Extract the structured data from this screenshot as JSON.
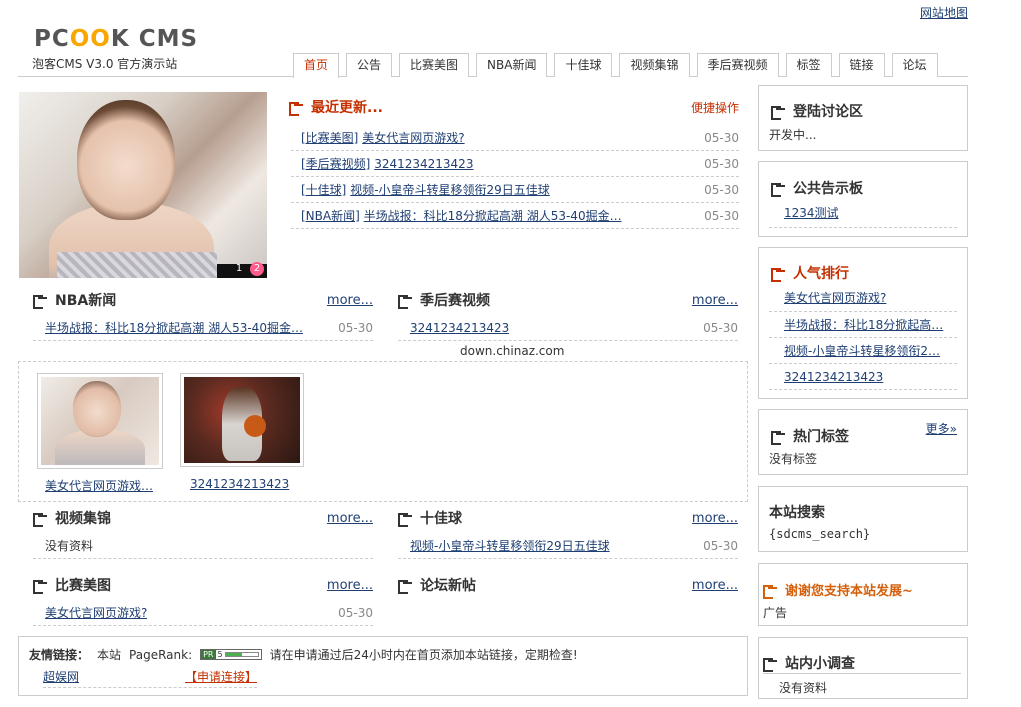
{
  "header": {
    "sitemap": "网站地图",
    "logo_prefix": "PC",
    "logo_oo": "OO",
    "logo_suffix": "K CMS",
    "subtitle": "泡客CMS V3.0 官方演示站",
    "nav": [
      "首页",
      "公告",
      "比赛美图",
      "NBA新闻",
      "十佳球",
      "视频集锦",
      "季后赛视频",
      "标签",
      "链接",
      "论坛"
    ],
    "active_tab": "首页"
  },
  "slider": {
    "pages": [
      "1",
      "2"
    ],
    "current": "2"
  },
  "recent": {
    "title": "最近更新...",
    "quick": "便捷操作",
    "items": [
      {
        "cat": "[比赛美图]",
        "title": "美女代言网页游戏?",
        "date": "05-30"
      },
      {
        "cat": "[季后赛视频]",
        "title": "3241234213423",
        "date": "05-30"
      },
      {
        "cat": "[十佳球]",
        "title": "视频-小皇帝斗转星移领衔29日五佳球",
        "date": "05-30"
      },
      {
        "cat": "[NBA新闻]",
        "title": "半场战报：科比18分掀起高潮 湖人53-40掘金…",
        "date": "05-30"
      }
    ]
  },
  "sections": {
    "nba": {
      "title": "NBA新闻",
      "more": "more...",
      "items": [
        {
          "title": "半场战报：科比18分掀起高潮 湖人53-40掘金…",
          "date": "05-30"
        }
      ]
    },
    "playoff": {
      "title": "季后赛视频",
      "more": "more...",
      "items": [
        {
          "title": "3241234213423",
          "date": "05-30"
        }
      ]
    },
    "video": {
      "title": "视频集锦",
      "more": "more...",
      "empty": "没有资料"
    },
    "top10": {
      "title": "十佳球",
      "more": "more...",
      "items": [
        {
          "title": "视频-小皇帝斗转星移领衔29日五佳球",
          "date": "05-30"
        }
      ]
    },
    "photos": {
      "title": "比赛美图",
      "more": "more...",
      "items": [
        {
          "title": "美女代言网页游戏?",
          "date": "05-30"
        }
      ]
    },
    "forum": {
      "title": "论坛新帖",
      "more": "more..."
    }
  },
  "watermark": "down.chinaz.com",
  "gallery": [
    {
      "caption": "美女代言网页游戏…"
    },
    {
      "caption": "3241234213423"
    }
  ],
  "links": {
    "label": "友情链接：",
    "site": "本站",
    "pagerank": "PageRank:",
    "pr_badge": "PR",
    "pr_value": "5",
    "pr_level": 0.5,
    "notice": "请在申请通过后24小时内在首页添加本站链接，定期检查!",
    "items": [
      "超娱网"
    ],
    "apply": "【申请连接】"
  },
  "sidebar": {
    "login": {
      "title": "登陆讨论区",
      "text": "开发中..."
    },
    "notice": {
      "title": "公共告示板",
      "items": [
        "1234测试"
      ]
    },
    "popular": {
      "title": "人气排行",
      "items": [
        "美女代言网页游戏?",
        "半场战报：科比18分掀起高…",
        "视频-小皇帝斗转星移领衔2…",
        "3241234213423"
      ]
    },
    "tags": {
      "title": "热门标签",
      "more": "更多»",
      "text": "没有标签"
    },
    "search": {
      "title": "本站搜索",
      "text": "{sdcms_search}"
    },
    "support": {
      "title": "谢谢您支持本站发展~",
      "text": "广告"
    },
    "survey": {
      "title": "站内小调查",
      "text": "没有资料"
    }
  },
  "colors": {
    "accent": "#c53000",
    "link": "#1f3f73",
    "orange": "#d4600c",
    "logo_oo": "#f7a700"
  }
}
